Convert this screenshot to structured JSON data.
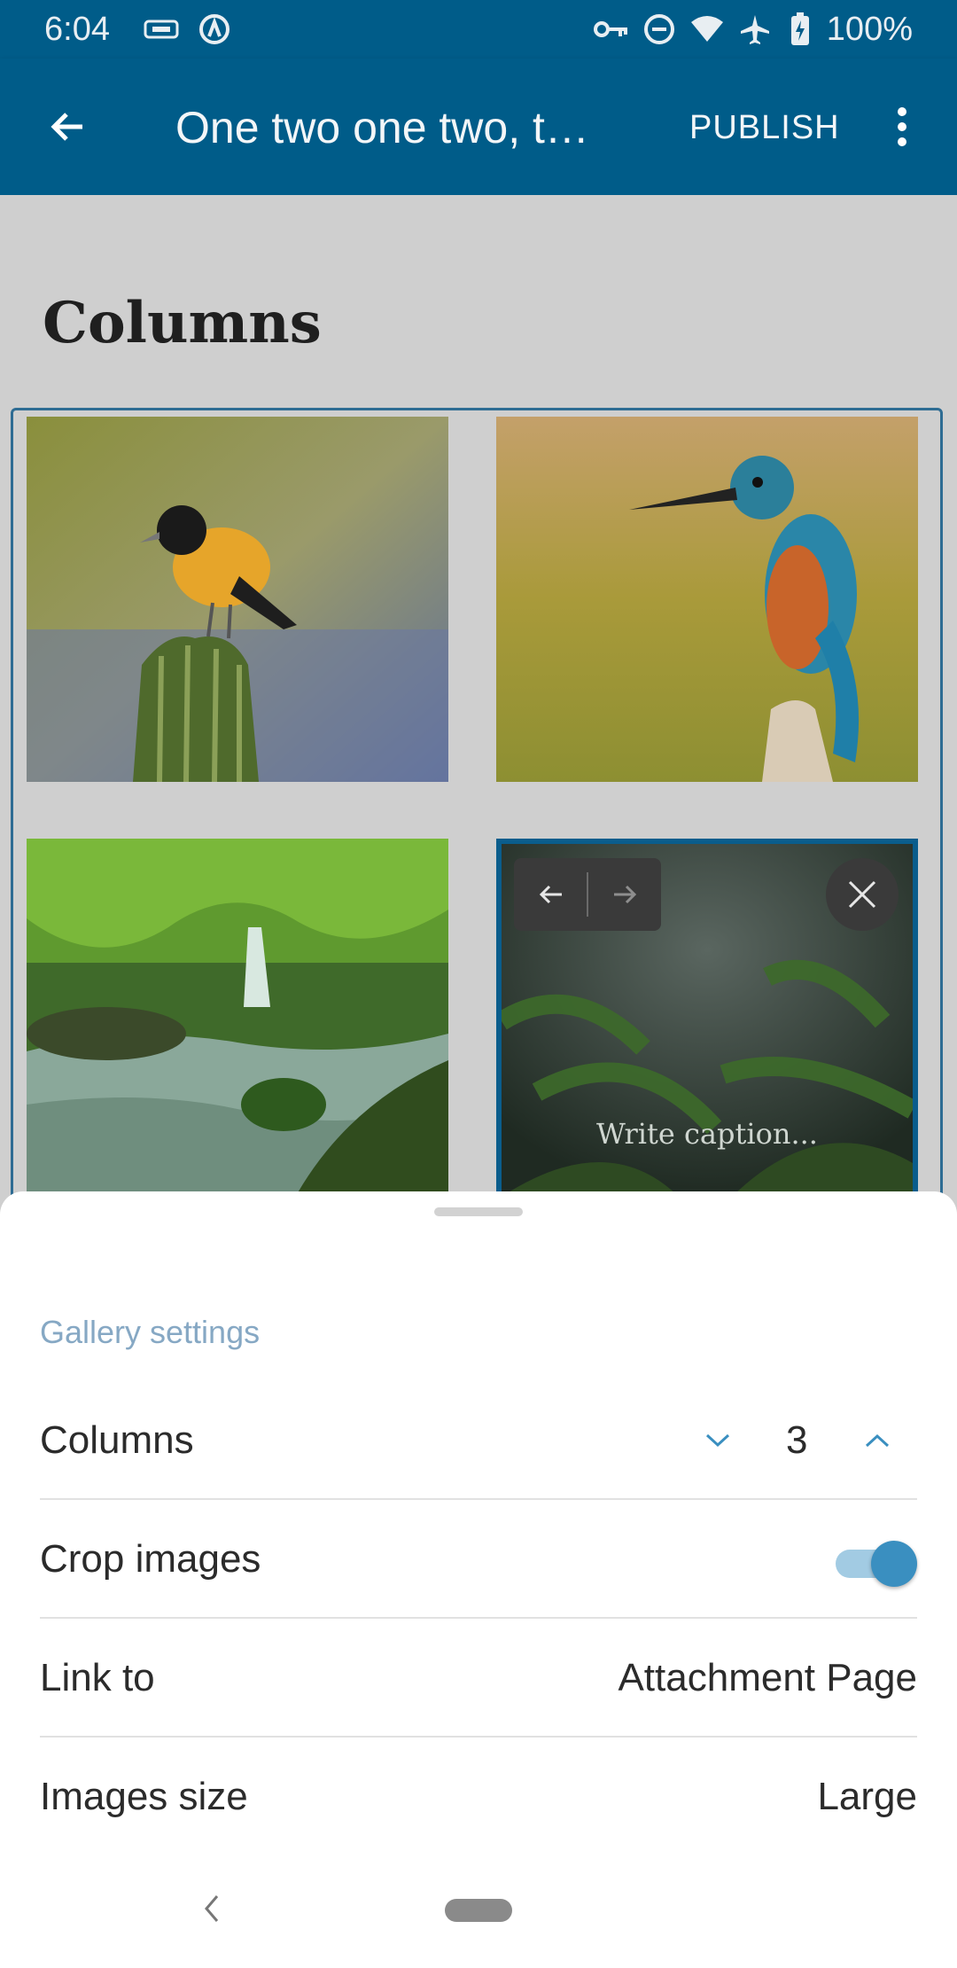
{
  "status_bar": {
    "time": "6:04",
    "battery": "100%",
    "icons": [
      "sdcard-icon",
      "sync-icon",
      "vpn-key-icon",
      "dnd-icon",
      "wifi-icon",
      "airplane-icon",
      "battery-charging-icon"
    ]
  },
  "app_bar": {
    "back_icon": "arrow-back-icon",
    "title": "One two one two, t…",
    "publish_label": "PUBLISH",
    "more_icon": "more-vert-icon"
  },
  "editor": {
    "heading": "Columns",
    "gallery": {
      "images": [
        {
          "subject": "bird on cactus"
        },
        {
          "subject": "kingfisher"
        },
        {
          "subject": "forest waterfall"
        },
        {
          "subject": "ferns",
          "selected": true
        }
      ],
      "caption_placeholder": "Write caption...",
      "controls": {
        "move_left_icon": "arrow-left-icon",
        "move_right_icon": "arrow-right-icon",
        "remove_icon": "close-icon"
      }
    }
  },
  "settings_sheet": {
    "title": "Gallery settings",
    "columns": {
      "label": "Columns",
      "value": "3"
    },
    "crop_images": {
      "label": "Crop images",
      "enabled": true
    },
    "link_to": {
      "label": "Link to",
      "value": "Attachment Page"
    },
    "images_size": {
      "label": "Images size",
      "value": "Large"
    }
  },
  "colors": {
    "primary": "#005c89",
    "accent": "#3a8fc0",
    "section_title": "#86a8c4"
  }
}
